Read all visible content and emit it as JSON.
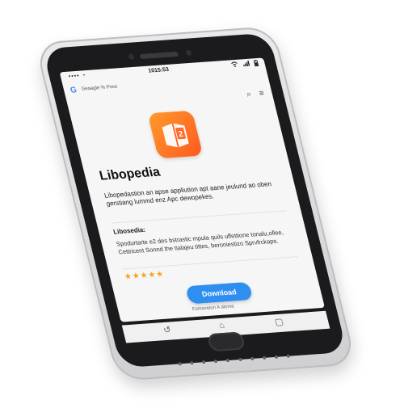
{
  "status_bar": {
    "dots": "•••• ◔",
    "time": "1015:53",
    "icons": [
      "wifi-icon",
      "signal-icon",
      "battery-icon"
    ]
  },
  "browser": {
    "brand_letter": "G",
    "url_text": "Geaagle % Pinor"
  },
  "toolbar": {
    "search_icon": "⌕",
    "menu_icon": "≡"
  },
  "app": {
    "name": "Libopedia",
    "icon_symbol": "2",
    "description": "Libopedastion an apse appliution apt aane jeulund ao oben gerstiang lummd enz Apc dewopekes.",
    "section_title": "Libosedia:",
    "section_body": "Spodurtarte e2 des bstrastic mpula quils uffettione tonalu,oflee, Cettricent Sonnd the tialajeu tittes, beroniestizo Sprvfrckaps.",
    "stars": "★★★★★",
    "download_label": "Download",
    "download_subtext": "Fsmoveion A alome"
  },
  "nav": {
    "back_icon": "↺",
    "home_icon": "⌂",
    "recents_icon": "▢"
  },
  "colors": {
    "accent": "#2f8ff0",
    "icon_orange": "#ff6a2a",
    "star": "#f3a417"
  }
}
